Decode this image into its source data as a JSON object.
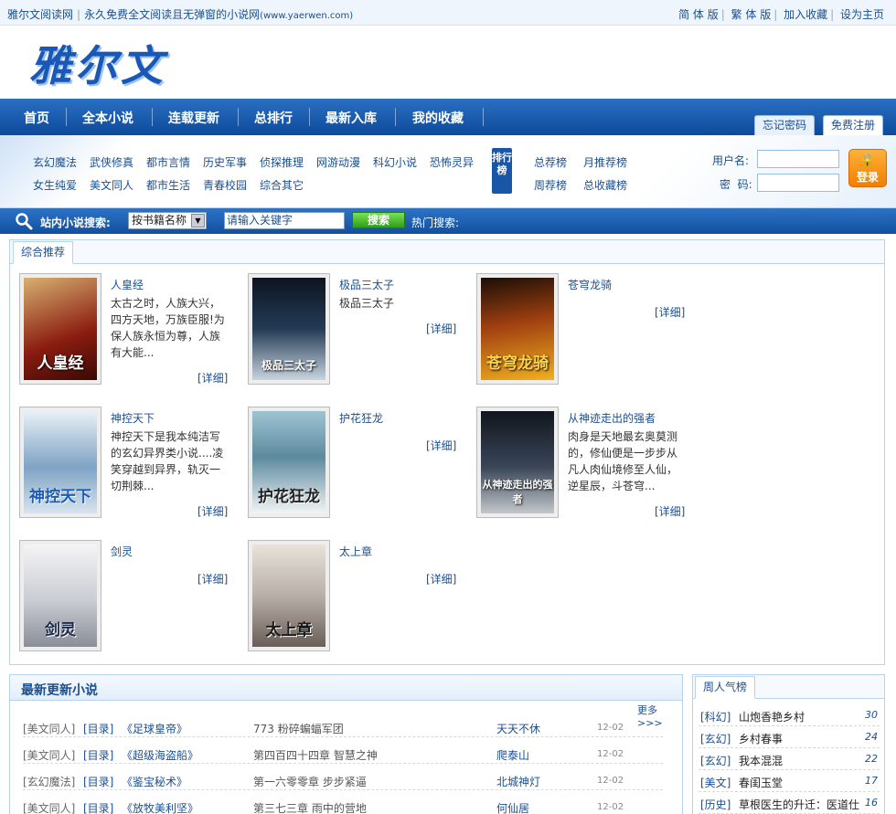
{
  "topbar": {
    "site_name": "雅尔文阅读网",
    "slogan": "永久免费全文阅读且无弹窗的小说网",
    "url": "(www.yaerwen.com)",
    "links": [
      "简 体 版",
      "繁 体 版",
      "加入收藏",
      "设为主页"
    ]
  },
  "logo": {
    "text": "雅尔文"
  },
  "nav": {
    "items": [
      "首页",
      "全本小说",
      "连载更新",
      "总排行",
      "最新入库",
      "我的收藏"
    ],
    "tabs": [
      "忘记密码",
      "免费注册"
    ]
  },
  "categories": {
    "row1": [
      "玄幻魔法",
      "武侠修真",
      "都市言情",
      "历史军事",
      "侦探推理",
      "网游动漫",
      "科幻小说",
      "恐怖灵异"
    ],
    "row2": [
      "女生纯爱",
      "美文同人",
      "都市生活",
      "青春校园",
      "综合其它"
    ],
    "rank_badge": "排行榜",
    "ranks_row1": [
      "总荐榜",
      "月推荐榜"
    ],
    "ranks_row2": [
      "周荐榜",
      "总收藏榜"
    ]
  },
  "login": {
    "username_label": "用户名:",
    "password_label": "密  码:",
    "button_label": "登录"
  },
  "search": {
    "label": "站内小说搜索:",
    "select_value": "按书籍名称",
    "keyword_placeholder": "请输入关键字",
    "button_label": "搜索",
    "hot_label": "热门搜索:"
  },
  "recommend": {
    "tab": "综合推荐",
    "detail_label": "[详细]",
    "books": [
      {
        "title": "人皇经",
        "desc": "太古之时，人族大兴，四方天地，万族臣服!为保人族永恒为尊，人族有大能...",
        "cover_text": "人皇经",
        "cover_color": "#8a1c10"
      },
      {
        "title": "极品三太子",
        "desc": "极品三太子",
        "cover_text": "极品三太子",
        "cover_color": "#243b55"
      },
      {
        "title": "苍穹龙骑",
        "desc": "",
        "cover_text": "苍穹龙骑",
        "cover_color": "#a04010"
      },
      {
        "title": "神控天下",
        "desc": "神控天下是我本纯洁写的玄幻异界类小说....凌笑穿越到异界，轨灭一切荆棘...",
        "cover_text": "神控天下",
        "cover_color": "#7fa3c4"
      },
      {
        "title": "护花狂龙",
        "desc": "",
        "cover_text": "护花狂龙",
        "cover_color": "#5d8a9e"
      },
      {
        "title": "从神迹走出的强者",
        "desc": "肉身是天地最玄奥莫测的，修仙便是一步步从凡人肉仙境修至人仙，逆星辰，斗苍穹...",
        "cover_text": "从神迹走出的强者",
        "cover_color": "#3a4658"
      },
      {
        "title": "剑灵",
        "desc": "",
        "cover_text": "剑灵",
        "cover_color": "#c9ccd2"
      },
      {
        "title": "太上章",
        "desc": "",
        "cover_text": "太上章",
        "cover_color": "#b8b0a8"
      }
    ]
  },
  "latest": {
    "title": "最新更新小说",
    "more": "更多>>>",
    "rows": [
      {
        "cat": "[美文同人]",
        "ml": "[目录]",
        "title": "《足球皇帝》",
        "chapter": "773 粉碎蝙蝠军团",
        "author": "天天不休",
        "date": "12-02"
      },
      {
        "cat": "[美文同人]",
        "ml": "[目录]",
        "title": "《超级海盗船》",
        "chapter": "第四百四十四章 智慧之神",
        "author": "爬泰山",
        "date": "12-02"
      },
      {
        "cat": "[玄幻魔法]",
        "ml": "[目录]",
        "title": "《鉴宝秘术》",
        "chapter": "第一六零零章 步步紧逼",
        "author": "北城神灯",
        "date": "12-02"
      },
      {
        "cat": "[美文同人]",
        "ml": "[目录]",
        "title": "《放牧美利坚》",
        "chapter": "第三七三章 雨中的营地",
        "author": "何仙居",
        "date": "12-02"
      }
    ]
  },
  "popular": {
    "tab": "周人气榜",
    "rows": [
      {
        "cat": "[科幻]",
        "title": "山炮香艳乡村",
        "num": "30"
      },
      {
        "cat": "[玄幻]",
        "title": "乡村春事",
        "num": "24"
      },
      {
        "cat": "[玄幻]",
        "title": "我本混混",
        "num": "22"
      },
      {
        "cat": "[美文]",
        "title": "春闺玉堂",
        "num": "17"
      },
      {
        "cat": "[历史]",
        "title": "草根医生的升迁：医道仕",
        "num": "16"
      }
    ]
  }
}
